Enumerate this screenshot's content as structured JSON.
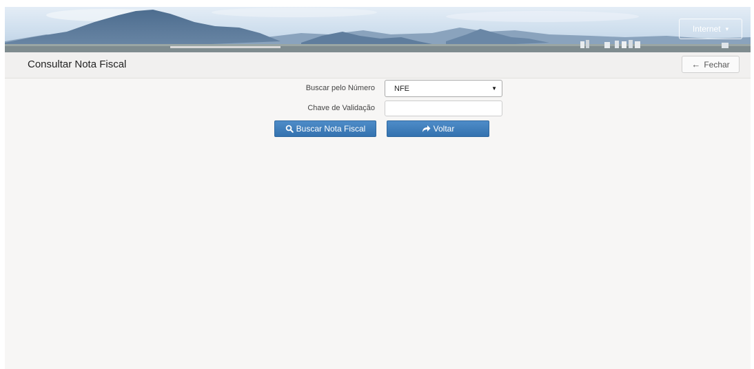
{
  "header": {
    "internet_label": "Internet",
    "internet_caret": "▾"
  },
  "titlebar": {
    "title": "Consultar Nota Fiscal",
    "close_label": "Fechar",
    "close_icon": "←"
  },
  "form": {
    "numero_label": "Buscar pelo Número",
    "numero_selected": "NFE",
    "select_arrow": "▼",
    "chave_label": "Chave de Validação",
    "chave_value": "",
    "buscar_label": "Buscar Nota Fiscal",
    "voltar_label": "Voltar"
  },
  "icons": {
    "internet_dropdown": "chevron-down-icon",
    "fechar": "arrow-left-icon",
    "buscar": "search-icon",
    "voltar": "share-arrow-icon"
  },
  "colors": {
    "primary_button": "#3a7bbf",
    "page_background": "#f7f6f5"
  }
}
